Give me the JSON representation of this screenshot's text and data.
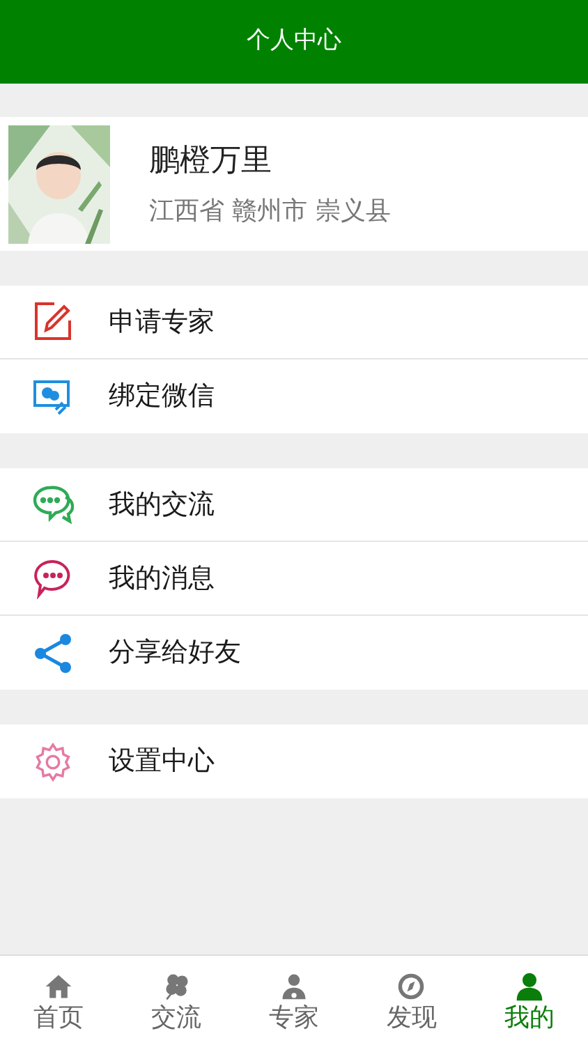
{
  "header": {
    "title": "个人中心"
  },
  "profile": {
    "name": "鹏橙万里",
    "location": "江西省 赣州市 崇义县"
  },
  "menu_groups": [
    {
      "items": [
        {
          "kind": "edit",
          "label": "申请专家"
        },
        {
          "kind": "wechat",
          "label": "绑定微信"
        }
      ]
    },
    {
      "items": [
        {
          "kind": "chat",
          "label": "我的交流"
        },
        {
          "kind": "message",
          "label": "我的消息"
        },
        {
          "kind": "share",
          "label": "分享给好友"
        }
      ]
    },
    {
      "items": [
        {
          "kind": "settings",
          "label": "设置中心"
        }
      ]
    }
  ],
  "tab_bar": [
    {
      "kind": "home",
      "label": "首页",
      "selected": false
    },
    {
      "kind": "clover",
      "label": "交流",
      "selected": false
    },
    {
      "kind": "doctor",
      "label": "专家",
      "selected": false
    },
    {
      "kind": "compass",
      "label": "发现",
      "selected": false
    },
    {
      "kind": "user",
      "label": "我的",
      "selected": true
    }
  ]
}
